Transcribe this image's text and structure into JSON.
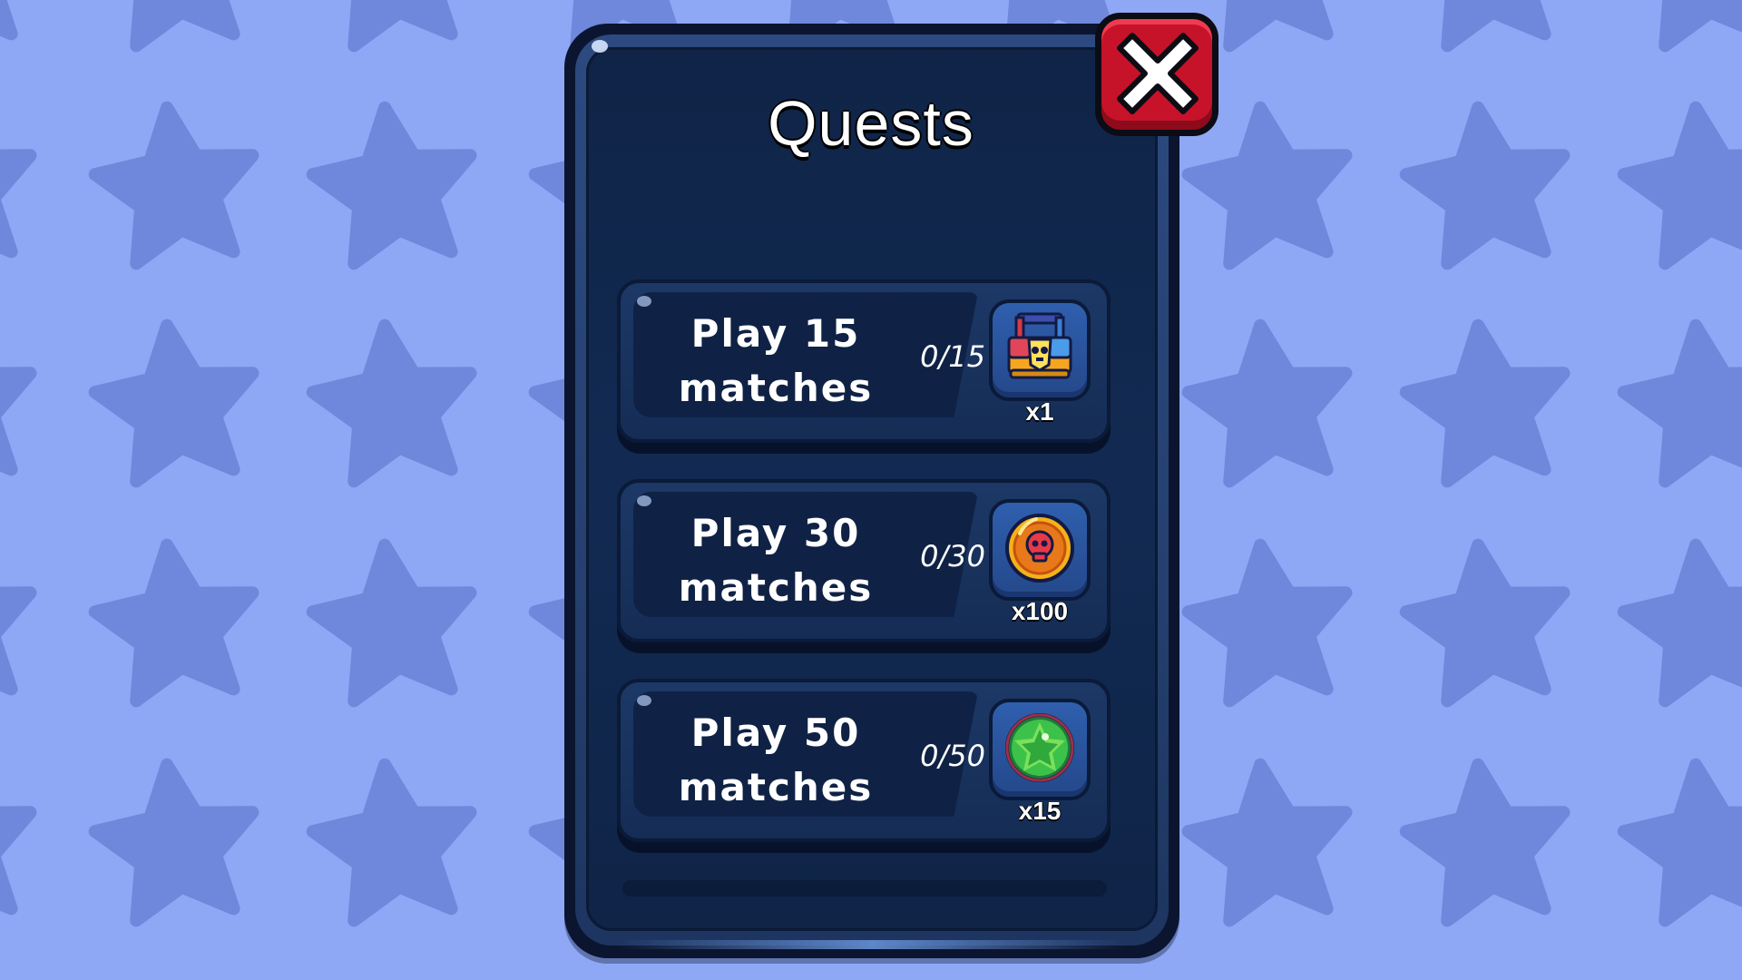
{
  "panel": {
    "title": "Quests",
    "close_icon": "close-x-icon"
  },
  "quests": [
    {
      "label_line1": "Play 15",
      "label_line2": "matches",
      "progress": "0/15",
      "reward_icon": "brawl-box-icon",
      "reward_qty": "x1"
    },
    {
      "label_line1": "Play 30",
      "label_line2": "matches",
      "progress": "0/30",
      "reward_icon": "coin-icon",
      "reward_qty": "x100"
    },
    {
      "label_line1": "Play 50",
      "label_line2": "matches",
      "progress": "0/50",
      "reward_icon": "gem-icon",
      "reward_qty": "x15"
    }
  ],
  "colors": {
    "background": "#8fa8f5",
    "star": "#7088dc",
    "panel": "#0f2447",
    "close": "#c6132a"
  }
}
